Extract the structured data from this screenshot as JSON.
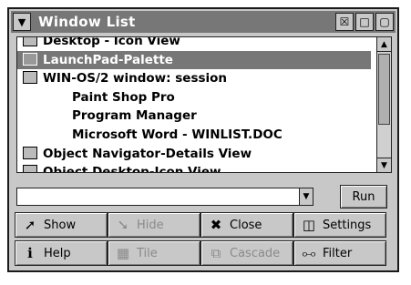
{
  "window": {
    "title": "Window List"
  },
  "title_buttons": {
    "close_glyph": "☒",
    "minimize_glyph": "□",
    "maximize_glyph": "▢"
  },
  "list": {
    "items": [
      {
        "label": "Desktop - Icon View",
        "icon": "desktop-icon",
        "indent": false,
        "selected": false
      },
      {
        "label": "LaunchPad-Palette",
        "icon": "launchpad-icon",
        "indent": false,
        "selected": true
      },
      {
        "label": "WIN-OS/2 window: session",
        "icon": "winos2-icon",
        "indent": false,
        "selected": false
      },
      {
        "label": "Paint Shop Pro",
        "icon": "",
        "indent": true,
        "selected": false
      },
      {
        "label": "Program Manager",
        "icon": "",
        "indent": true,
        "selected": false
      },
      {
        "label": "Microsoft Word - WINLIST.DOC",
        "icon": "",
        "indent": true,
        "selected": false
      },
      {
        "label": "Object Navigator-Details View",
        "icon": "object-navigator-icon",
        "indent": false,
        "selected": false
      },
      {
        "label": "Object Desktop-Icon View",
        "icon": "object-desktop-icon",
        "indent": false,
        "selected": false
      }
    ]
  },
  "command": {
    "value": "",
    "run_label": "Run"
  },
  "buttons": {
    "show": "Show",
    "hide": "Hide",
    "close": "Close",
    "settings": "Settings",
    "help": "Help",
    "tile": "Tile",
    "cascade": "Cascade",
    "filter": "Filter"
  }
}
